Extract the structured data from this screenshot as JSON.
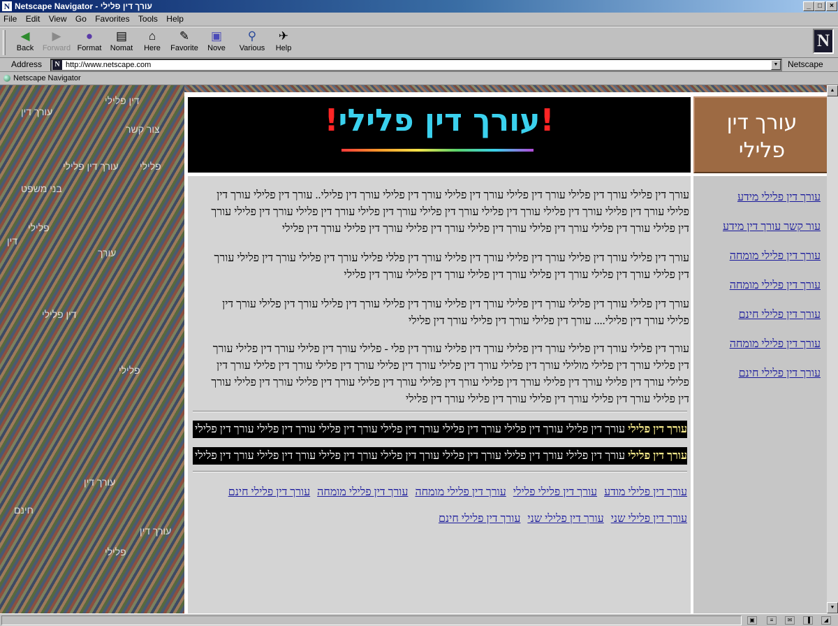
{
  "window": {
    "title": "Netscape Navigator - עורך דין פלילי",
    "app_icon": "N"
  },
  "menu": [
    "File",
    "Edit",
    "View",
    "Go",
    "Favorites",
    "Tools",
    "Help"
  ],
  "toolbar": [
    {
      "label": "Back",
      "icon": "back-icon",
      "glyph": "◀",
      "disabled": false
    },
    {
      "label": "Forward",
      "icon": "forward-icon",
      "glyph": "▶",
      "disabled": true
    },
    {
      "label": "Format",
      "icon": "format-icon",
      "glyph": "●",
      "disabled": false
    },
    {
      "label": "Nomat",
      "icon": "nomat-icon",
      "glyph": "▤",
      "disabled": false
    },
    {
      "label": "Here",
      "icon": "home-icon",
      "glyph": "⌂",
      "disabled": false
    },
    {
      "label": "Favorite",
      "icon": "favorite-icon",
      "glyph": "✎",
      "disabled": false
    },
    {
      "label": "Nove",
      "icon": "nove-icon",
      "glyph": "▣",
      "disabled": false
    },
    {
      "label": "Various",
      "icon": "various-icon",
      "glyph": "⚲",
      "disabled": false
    },
    {
      "label": "Help",
      "icon": "help-icon",
      "glyph": "✈",
      "disabled": false
    }
  ],
  "brand_logo": "N",
  "address": {
    "label": "Address",
    "url": "http://www.netscape.com",
    "netscape_label": "Netscape"
  },
  "links_bar": {
    "label": "Netscape Navigator"
  },
  "page": {
    "banner": {
      "bang": "!",
      "title": "עורך דין פלילי"
    },
    "brand_box": {
      "line1": "עורך דין",
      "line2": "פלילי"
    },
    "sidebar_links": [
      "עורך דין פלילי מידע",
      "עור קשר עורך דין מידע",
      "עורך דין פלילי מומחה",
      "עורך דין פלילי מומחה",
      "עורך דין פלילי חינם",
      "עורך דין פלילי מומחה",
      "עורך דין פלילי חינם"
    ],
    "paragraphs": [
      "עורך דין פלילי עורך דין פלילי עורך דין פלילי עורך דין פלילי עורך דין פלילי עורך דין פלילי.. עורך דין פלילי עורך דין פלילי עורך דין פלילי עורך דין פלילי עורך דין פלילי עורך דין פלילי עורך דין פלילי עורך דין פלילי עורך דין פלילי עורך דין פלילי עורך דין פלילי עורך דין פלילי עורך דין פלילי עורך דין פלילי עורך דין פלילי עורך דין פלילי",
      "עורך דין פלילי עורך דין פלילי עורך דין פלילי עורך דין פלילי עורך דין פללי פלילי עורך דין פלילי עורך דין פלילי עורך דין פלילי עורך דין פלילי עורך דין פלילי עורך דין פלילי עורך דין פלילי עורך דין פלילי",
      "עורך דין פלילי עורך דין פלילי עורך דין פלילי עורך דין פלילי עורך דין פלילי עורך דין פלילי עורך דין פלילי עורך דין פלילי עורך דין פלילי.... עורך דין פלילי עורך דין פלילי עורך דין פלילי",
      "עורך דין פלילי עורך דין פלילי עורך דין פלילי עורך דין פלילי עורך דין פלי - פלילי עורך דין פלילי עורך דין פלילי עורך דין פלילי עורך דין פלילי מולילי עורך דין פלילי עורך דין פלילי עורך דין פלילי עורך דין פלילי עורך דין פלילי עורך דין פלילי עורך דין פלילי עורך דין פלילי עורך דין פלילי עורך דין פלילי עורך דין פלילי עורך דין פלילי עורך דין פלילי עורך דין פלילי עורך דין פלילי עורך דין פלילי עורך דין פלילי עורך דין פלילי"
    ],
    "ticker1": {
      "bold": "עורך דין פלילי",
      "rest": "עורך דין פלילי עורך דין פלילי עורך דין פלילי עורך דין פלילי עורך דין פלילי עורך דין פלילי עורך דין פלילי עורך דין פלילי עורך דין פלילי עורך דין פלילי"
    },
    "ticker2": {
      "bold": "עורך דין פלילי",
      "rest": "עורך דין פלילי עורך דין פלילי עורך דין פלילי עורך דין פלילי עורך דין פלילי עורך דין פלילי עורך דין פלילי עורך דין פלילי עורך דין פלילי עורך דין פלילי"
    },
    "bottom_links_row1": [
      "עורך דין פלילי מודע",
      "עורך דין פלילי פלילי",
      "עורך דין פלילי מומחה",
      "עורך דין פלילי מומחה",
      "עורך דין פלילי חינם"
    ],
    "bottom_links_row2": [
      "עורך דין פלילי שני",
      "עורך דין פלילי שני",
      "עורך דין פלילי חינם"
    ],
    "background_watermarks": [
      "דין פלילי",
      "עורך דין",
      "צור קשר",
      "עורך דין פלילי",
      "פלילי",
      "דין",
      "עורך",
      "בני משפט",
      "עורך דין",
      "דין פלילי",
      "פלילי",
      "עורך דין",
      "חינם",
      "פלילי",
      "עורך דין"
    ]
  }
}
